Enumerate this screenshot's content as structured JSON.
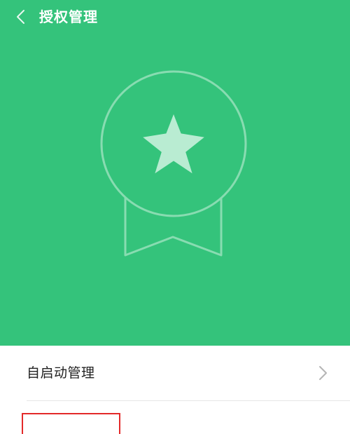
{
  "header": {
    "title": "授权管理",
    "background_color": "#34c37b"
  },
  "hero": {
    "icon": "award-badge-icon"
  },
  "list": {
    "items": [
      {
        "label": "自启动管理",
        "icon": "chevron-right-icon"
      }
    ]
  },
  "annotation": {
    "highlight_color": "#e32a2a"
  }
}
